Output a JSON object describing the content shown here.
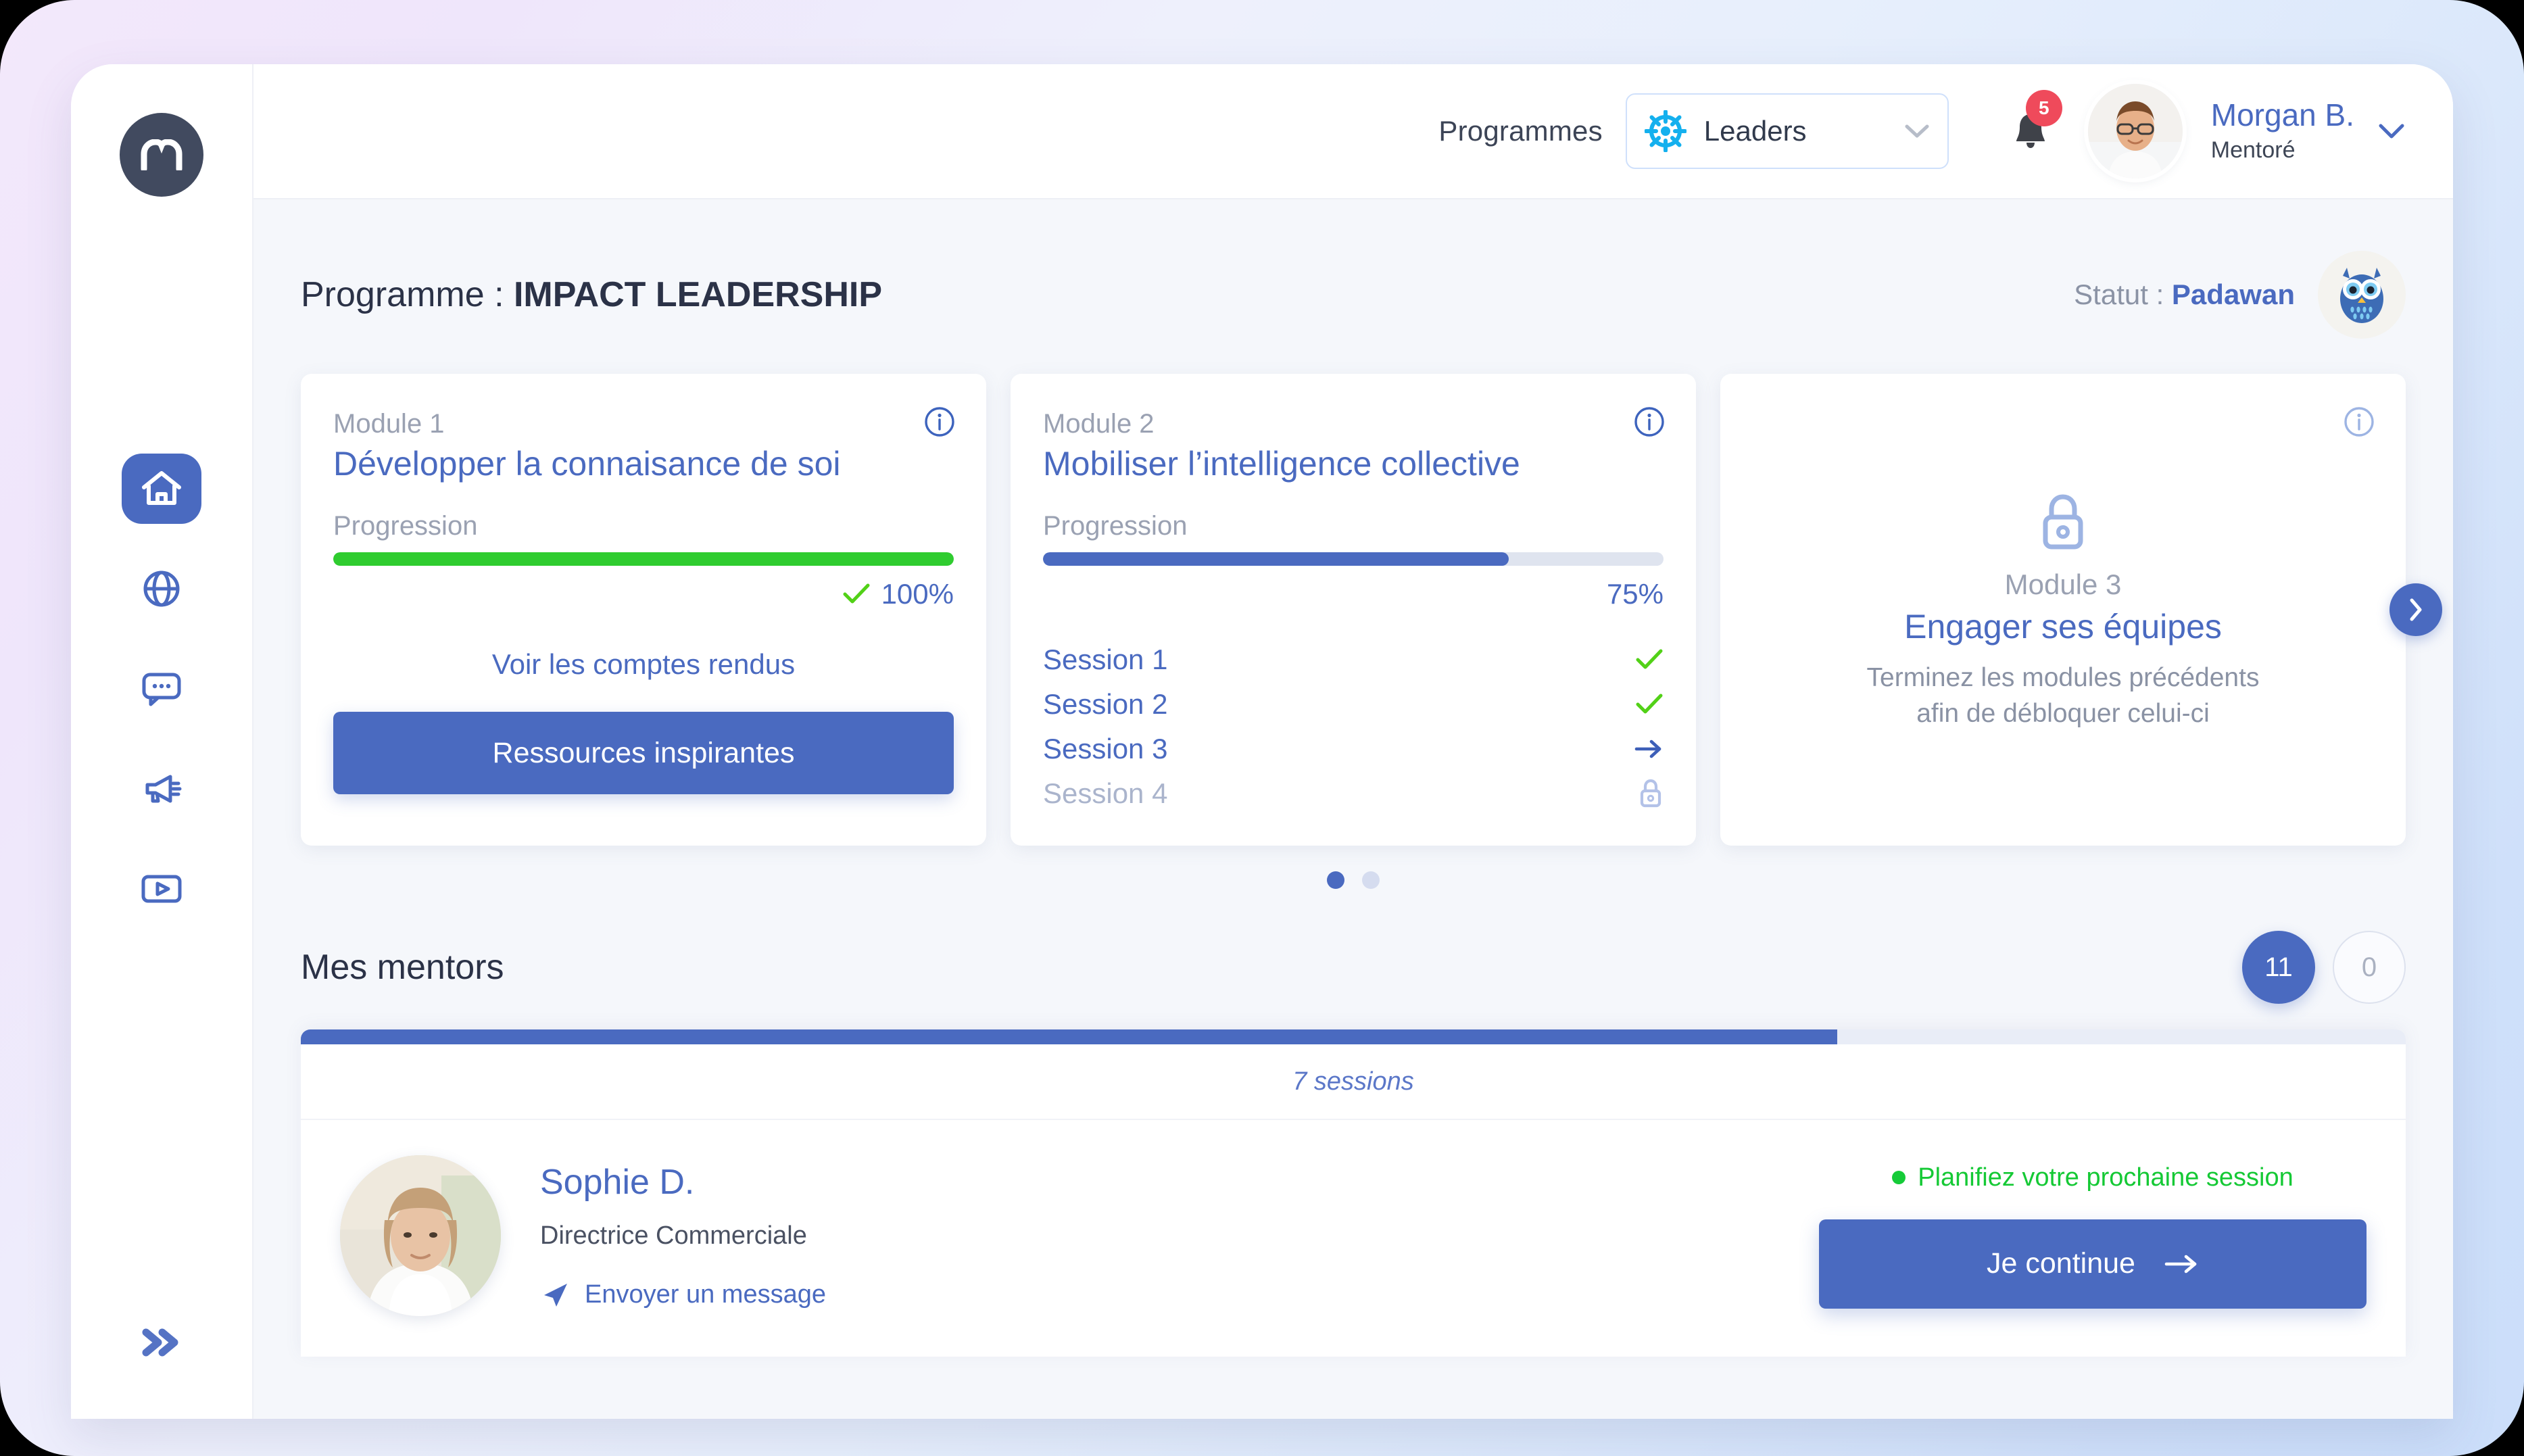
{
  "colors": {
    "brand_blue": "#4a6ac0",
    "green": "#2fcc2f",
    "status_green": "#15c935",
    "grey_text": "#9aa1b2",
    "dark_text": "#2b3247",
    "badge_red": "#ef4a5b",
    "wheel_cyan": "#14b0ee",
    "logo_dark": "#414a5f"
  },
  "sidebar": {
    "logo_icon": "mentor-logo-icon",
    "items": [
      {
        "icon": "home-icon",
        "name": "home",
        "active": true
      },
      {
        "icon": "globe-icon",
        "name": "globe",
        "active": false
      },
      {
        "icon": "chat-bubble-icon",
        "name": "messages",
        "active": false
      },
      {
        "icon": "megaphone-icon",
        "name": "announcements",
        "active": false
      },
      {
        "icon": "video-play-icon",
        "name": "videos",
        "active": false
      }
    ],
    "expand_icon": "chevron-double-right-icon"
  },
  "header": {
    "programmes_label": "Programmes",
    "program_select": {
      "value": "Leaders",
      "icon": "ship-wheel-icon",
      "caret_icon": "chevron-down-icon"
    },
    "notifications": {
      "icon": "bell-icon",
      "count": "5"
    },
    "user": {
      "avatar_icon": "user-avatar",
      "name": "Morgan B.",
      "role": "Mentoré",
      "caret_icon": "chevron-down-icon"
    }
  },
  "page": {
    "program_prefix": "Programme : ",
    "program_name": "IMPACT LEADERSHIP",
    "status_prefix": "Statut : ",
    "status_value": "Padawan",
    "status_icon": "owl-badge-icon"
  },
  "modules": [
    {
      "label": "Module 1",
      "title": "Développer la connaisance de soi",
      "progress_caption": "Progression",
      "progress_value": 100,
      "progress_text": "100%",
      "progress_color": "#2fcc2f",
      "check_icon": "check-icon",
      "link_label": "Voir les comptes rendus",
      "button_label": "Ressources inspirantes",
      "info_icon": "info-icon",
      "locked": false
    },
    {
      "label": "Module 2",
      "title": "Mobiliser l’intelligence collective",
      "progress_caption": "Progression",
      "progress_value": 75,
      "progress_text": "75%",
      "progress_color": "#4a6ac0",
      "info_icon": "info-icon",
      "locked": false,
      "sessions": [
        {
          "name": "Session 1",
          "state": "done",
          "icon": "check-icon"
        },
        {
          "name": "Session 2",
          "state": "done",
          "icon": "check-icon"
        },
        {
          "name": "Session 3",
          "state": "current",
          "icon": "arrow-right-icon"
        },
        {
          "name": "Session 4",
          "state": "locked",
          "icon": "lock-icon"
        }
      ]
    },
    {
      "label": "Module 3",
      "title": "Engager ses équipes",
      "locked": true,
      "lock_icon": "lock-icon",
      "info_icon": "info-icon",
      "locked_message_line1": "Terminez les modules précédents",
      "locked_message_line2": "afin de débloquer celui-ci"
    }
  ],
  "carousel": {
    "next_icon": "chevron-right-icon",
    "dots": [
      {
        "active": true
      },
      {
        "active": false
      }
    ]
  },
  "mentors": {
    "section_title": "Mes mentors",
    "counters": [
      {
        "value": "11",
        "style": "filled"
      },
      {
        "value": "0",
        "style": "hollow"
      }
    ],
    "progress_fill_percent": 73,
    "sessions_count": "7 sessions",
    "mentor": {
      "photo_icon": "mentor-photo",
      "name": "Sophie D.",
      "role": "Directrice Commerciale",
      "message_link": "Envoyer un message",
      "message_icon": "paper-plane-icon",
      "status_text": "Planifiez votre prochaine session",
      "status_dot_color": "#15cb38",
      "cta_label": "Je continue",
      "cta_icon": "arrow-right-icon"
    }
  }
}
